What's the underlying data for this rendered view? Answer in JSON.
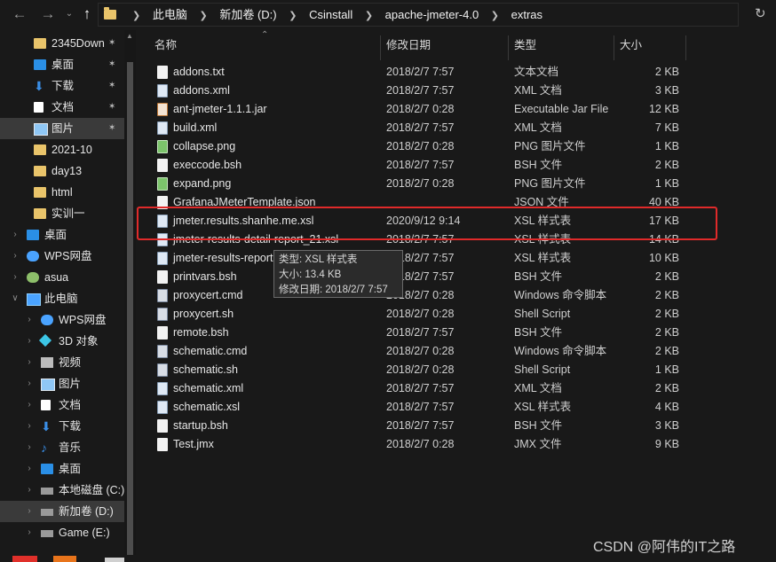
{
  "toolbar": {
    "back_icon": "arrow-left-icon",
    "forward_icon": "arrow-right-icon",
    "recent_icon": "chevron-down-icon",
    "up_icon": "arrow-up-icon"
  },
  "address": {
    "crumbs": [
      "此电脑",
      "新加卷 (D:)",
      "Csinstall",
      "apache-jmeter-4.0",
      "extras"
    ]
  },
  "sidebar": {
    "items": [
      {
        "label": "2345Down",
        "icon": "folder-icon",
        "pinned": true
      },
      {
        "label": "桌面",
        "icon": "desktop-icon",
        "pinned": true
      },
      {
        "label": "下载",
        "icon": "download-icon",
        "pinned": true
      },
      {
        "label": "文档",
        "icon": "document-icon",
        "pinned": true
      },
      {
        "label": "图片",
        "icon": "picture-icon",
        "pinned": true,
        "selected": true
      },
      {
        "label": "2021-10",
        "icon": "folder-icon"
      },
      {
        "label": "day13",
        "icon": "folder-icon"
      },
      {
        "label": "html",
        "icon": "folder-icon"
      },
      {
        "label": "实训一",
        "icon": "folder-icon"
      },
      {
        "label": "桌面",
        "icon": "desktop-icon",
        "expandable": true
      },
      {
        "label": "WPS网盘",
        "icon": "cloud-icon",
        "expandable": true
      },
      {
        "label": "asua",
        "icon": "user-icon",
        "expandable": true
      },
      {
        "label": "此电脑",
        "icon": "computer-icon",
        "expandable": true,
        "expanded": true
      },
      {
        "label": "WPS网盘",
        "icon": "cloud-icon",
        "expandable": true
      },
      {
        "label": "3D 对象",
        "icon": "3d-objects-icon",
        "expandable": true
      },
      {
        "label": "视频",
        "icon": "video-icon",
        "expandable": true
      },
      {
        "label": "图片",
        "icon": "picture-icon",
        "expandable": true
      },
      {
        "label": "文档",
        "icon": "document-icon",
        "expandable": true
      },
      {
        "label": "下载",
        "icon": "download-icon",
        "expandable": true
      },
      {
        "label": "音乐",
        "icon": "music-icon",
        "expandable": true
      },
      {
        "label": "桌面",
        "icon": "desktop-icon",
        "expandable": true
      },
      {
        "label": "本地磁盘 (C:)",
        "icon": "drive-icon",
        "expandable": true
      },
      {
        "label": "新加卷 (D:)",
        "icon": "drive-icon",
        "expandable": true,
        "selected": true
      },
      {
        "label": "Game (E:)",
        "icon": "drive-icon",
        "expandable": true
      }
    ]
  },
  "columns": {
    "name": "名称",
    "date": "修改日期",
    "type": "类型",
    "size": "大小"
  },
  "files": [
    {
      "name": "addons.txt",
      "date": "2018/2/7 7:57",
      "type": "文本文档",
      "size": "2 KB",
      "icon": "text-file-icon"
    },
    {
      "name": "addons.xml",
      "date": "2018/2/7 7:57",
      "type": "XML 文档",
      "size": "3 KB",
      "icon": "xml-file-icon"
    },
    {
      "name": "ant-jmeter-1.1.1.jar",
      "date": "2018/2/7 0:28",
      "type": "Executable Jar File",
      "size": "12 KB",
      "icon": "jar-file-icon"
    },
    {
      "name": "build.xml",
      "date": "2018/2/7 7:57",
      "type": "XML 文档",
      "size": "7 KB",
      "icon": "xml-file-icon"
    },
    {
      "name": "collapse.png",
      "date": "2018/2/7 0:28",
      "type": "PNG 图片文件",
      "size": "1 KB",
      "icon": "png-file-icon"
    },
    {
      "name": "execcode.bsh",
      "date": "2018/2/7 7:57",
      "type": "BSH 文件",
      "size": "2 KB",
      "icon": "file-icon"
    },
    {
      "name": "expand.png",
      "date": "2018/2/7 0:28",
      "type": "PNG 图片文件",
      "size": "1 KB",
      "icon": "png-file-icon"
    },
    {
      "name": "GrafanaJMeterTemplate.json",
      "date": "",
      "type": "JSON 文件",
      "size": "40 KB",
      "icon": "file-icon"
    },
    {
      "name": "jmeter.results.shanhe.me.xsl",
      "date": "2020/9/12 9:14",
      "type": "XSL 样式表",
      "size": "17 KB",
      "icon": "xml-file-icon"
    },
    {
      "name": "jmeter-results-detail-report_21.xsl",
      "date": "2018/2/7 7:57",
      "type": "XSL 样式表",
      "size": "14 KB",
      "icon": "xml-file-icon"
    },
    {
      "name": "jmeter-results-report",
      "date": "2018/2/7 7:57",
      "type": "XSL 样式表",
      "size": "10 KB",
      "icon": "xml-file-icon"
    },
    {
      "name": "printvars.bsh",
      "date": "2018/2/7 7:57",
      "type": "BSH 文件",
      "size": "2 KB",
      "icon": "file-icon"
    },
    {
      "name": "proxycert.cmd",
      "date": "2018/2/7 0:28",
      "type": "Windows 命令脚本",
      "size": "2 KB",
      "icon": "cmd-file-icon"
    },
    {
      "name": "proxycert.sh",
      "date": "2018/2/7 0:28",
      "type": "Shell Script",
      "size": "2 KB",
      "icon": "cmd-file-icon"
    },
    {
      "name": "remote.bsh",
      "date": "2018/2/7 7:57",
      "type": "BSH 文件",
      "size": "2 KB",
      "icon": "file-icon"
    },
    {
      "name": "schematic.cmd",
      "date": "2018/2/7 0:28",
      "type": "Windows 命令脚本",
      "size": "2 KB",
      "icon": "cmd-file-icon"
    },
    {
      "name": "schematic.sh",
      "date": "2018/2/7 0:28",
      "type": "Shell Script",
      "size": "1 KB",
      "icon": "cmd-file-icon"
    },
    {
      "name": "schematic.xml",
      "date": "2018/2/7 7:57",
      "type": "XML 文档",
      "size": "2 KB",
      "icon": "xml-file-icon"
    },
    {
      "name": "schematic.xsl",
      "date": "2018/2/7 7:57",
      "type": "XSL 样式表",
      "size": "4 KB",
      "icon": "xml-file-icon"
    },
    {
      "name": "startup.bsh",
      "date": "2018/2/7 7:57",
      "type": "BSH 文件",
      "size": "3 KB",
      "icon": "file-icon"
    },
    {
      "name": "Test.jmx",
      "date": "2018/2/7 0:28",
      "type": "JMX 文件",
      "size": "9 KB",
      "icon": "file-icon"
    }
  ],
  "tooltip": {
    "type_line": "类型: XSL 样式表",
    "size_line": "大小: 13.4 KB",
    "date_line": "修改日期: 2018/2/7 7:57"
  },
  "highlight_color": "#e02a2a",
  "watermark": "CSDN @阿伟的IT之路"
}
